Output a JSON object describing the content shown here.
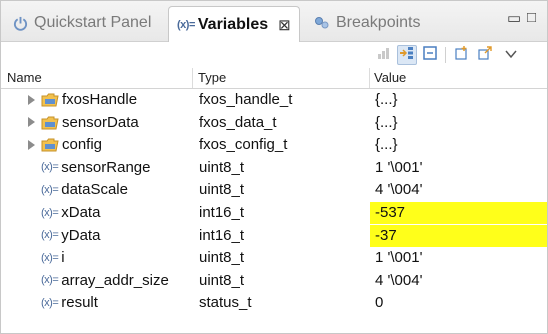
{
  "tabs": [
    {
      "label": "Quickstart Panel",
      "icon": "power-icon"
    },
    {
      "label": "Variables",
      "prefix": "(x)=",
      "close": "⊠",
      "icon": "variables-icon"
    },
    {
      "label": "Breakpoints",
      "icon": "breakpoints-icon"
    }
  ],
  "window_controls": {
    "minimize": "▭",
    "maximize": "□"
  },
  "toolbar": {
    "icons": [
      "show-type-names-icon",
      "show-logical-structure-icon",
      "collapse-all-icon",
      "new-expression-icon",
      "export-icon",
      "view-menu-icon"
    ]
  },
  "columns": {
    "name": "Name",
    "type": "Type",
    "value": "Value"
  },
  "rows": [
    {
      "name": "fxosHandle",
      "type": "fxos_handle_t",
      "value": "{...}",
      "expandable": true,
      "icon": "struct-icon",
      "highlighted": false
    },
    {
      "name": "sensorData",
      "type": "fxos_data_t",
      "value": "{...}",
      "expandable": true,
      "icon": "struct-icon",
      "highlighted": false
    },
    {
      "name": "config",
      "type": "fxos_config_t",
      "value": "{...}",
      "expandable": true,
      "icon": "struct-icon",
      "highlighted": false
    },
    {
      "name": "sensorRange",
      "type": "uint8_t",
      "value": "1 '\\001'",
      "expandable": false,
      "icon": "variable-icon",
      "highlighted": false
    },
    {
      "name": "dataScale",
      "type": "uint8_t",
      "value": "4 '\\004'",
      "expandable": false,
      "icon": "variable-icon",
      "highlighted": false
    },
    {
      "name": "xData",
      "type": "int16_t",
      "value": "-537",
      "expandable": false,
      "icon": "variable-icon",
      "highlighted": true
    },
    {
      "name": "yData",
      "type": "int16_t",
      "value": "-37",
      "expandable": false,
      "icon": "variable-icon",
      "highlighted": true
    },
    {
      "name": "i",
      "type": "uint8_t",
      "value": "1 '\\001'",
      "expandable": false,
      "icon": "variable-icon",
      "highlighted": false
    },
    {
      "name": "array_addr_size",
      "type": "uint8_t",
      "value": "4 '\\004'",
      "expandable": false,
      "icon": "variable-icon",
      "highlighted": false
    },
    {
      "name": "result",
      "type": "status_t",
      "value": "0",
      "expandable": false,
      "icon": "variable-icon",
      "highlighted": false
    }
  ],
  "colors": {
    "highlight": "#ffff1a",
    "struct_folder": "#f2c14e",
    "variable": "#4a6a9a"
  }
}
